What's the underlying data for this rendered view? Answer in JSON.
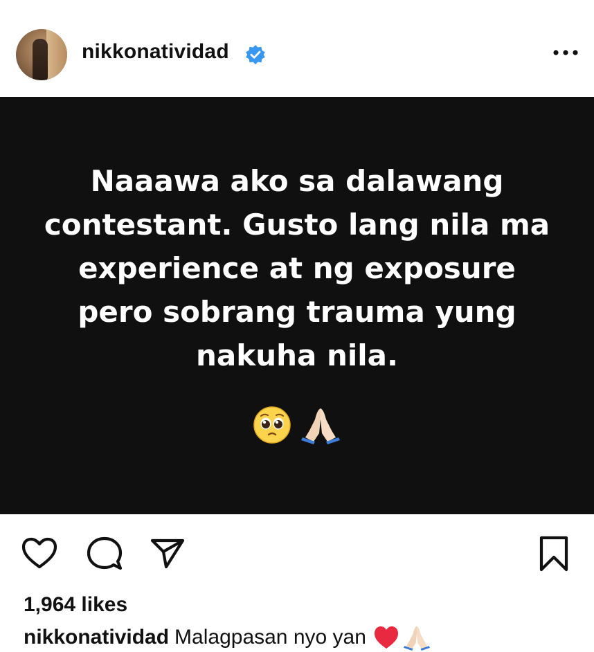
{
  "header": {
    "username": "nikkonatividad",
    "verified": true,
    "more_icon": "more-horizontal-icon"
  },
  "post": {
    "text": "Naaawa ako sa dalawang contestant. Gusto lang nila ma experience at ng exposure pero sobrang trauma yung nakuha nila.",
    "emojis": [
      "pleading-face-emoji",
      "folded-hands-emoji"
    ],
    "background": "#101010",
    "text_color": "#ffffff"
  },
  "actions": {
    "like_icon": "heart-icon",
    "comment_icon": "comment-icon",
    "share_icon": "send-icon",
    "save_icon": "bookmark-icon"
  },
  "likes": "1,964 likes",
  "caption": {
    "username": "nikkonatividad",
    "text": "Malagpasan nyo yan",
    "emojis": [
      "red-heart-emoji",
      "folded-hands-emoji"
    ]
  },
  "colors": {
    "verified_blue": "#3897f0",
    "heart_red": "#e0245e"
  }
}
